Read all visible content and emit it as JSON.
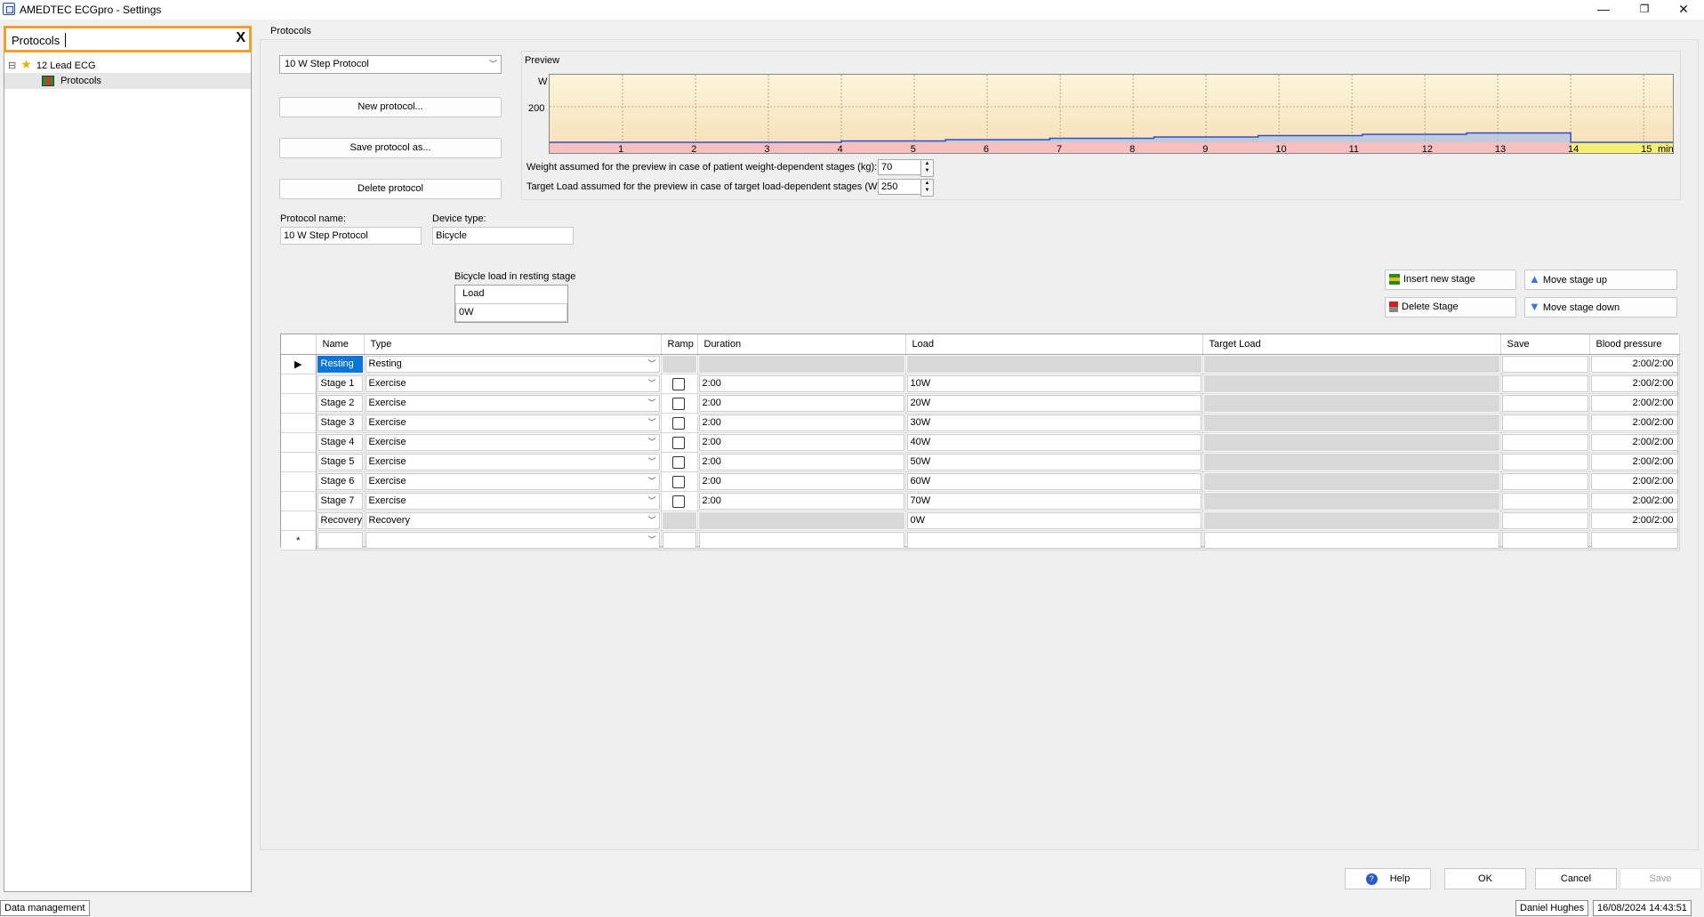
{
  "window": {
    "title": "AMEDTEC ECGpro  -  Settings",
    "minimize": "—",
    "restore": "❐",
    "close": "✕"
  },
  "search": {
    "value": "Protocols",
    "clear": "X"
  },
  "tree": {
    "root": "12 Lead ECG",
    "expander": "⊟",
    "child": "Protocols"
  },
  "group_title": "Protocols",
  "protocol_select": {
    "value": "10 W Step Protocol"
  },
  "buttons": {
    "new_protocol": "New protocol...",
    "save_protocol_as": "Save protocol as...",
    "delete_protocol": "Delete protocol",
    "insert_stage": "Insert new stage",
    "move_up": "Move stage up",
    "delete_stage": "Delete Stage",
    "move_down": "Move stage down",
    "help": "Help",
    "ok": "OK",
    "cancel": "Cancel",
    "save": "Save"
  },
  "preview": {
    "title": "Preview",
    "y_unit": "W",
    "y_tick": "200",
    "x_ticks": [
      "1",
      "2",
      "3",
      "4",
      "5",
      "6",
      "7",
      "8",
      "9",
      "10",
      "11",
      "12",
      "13",
      "14",
      "15",
      "min"
    ],
    "stage_loads_w": [
      0,
      0,
      0,
      0,
      10,
      20,
      30,
      40,
      50,
      60,
      70,
      0
    ],
    "weight_label": "Weight assumed for the preview in case of patient weight-dependent stages (kg):",
    "weight_value": "70",
    "target_label": "Target Load assumed for the preview in case of target load-dependent stages (W):",
    "target_value": "250"
  },
  "protocol_name": {
    "label": "Protocol name:",
    "value": "10 W Step Protocol"
  },
  "device_type": {
    "label": "Device type:",
    "value": "Bicycle"
  },
  "resting_load": {
    "label": "Bicycle load in resting stage",
    "header": "Load",
    "value": "0W"
  },
  "table": {
    "columns": [
      "Name",
      "Type",
      "Ramp",
      "Duration",
      "Load",
      "Target Load",
      "Save",
      "Blood pressure"
    ],
    "rows": [
      {
        "marker": "▶",
        "name": "Resting",
        "type": "Resting",
        "ramp": false,
        "duration": "",
        "load": "",
        "bp": "2:00/2:00"
      },
      {
        "marker": "",
        "name": "Stage 1",
        "type": "Exercise",
        "ramp": true,
        "duration": "2:00",
        "load": "10W",
        "bp": "2:00/2:00"
      },
      {
        "marker": "",
        "name": "Stage 2",
        "type": "Exercise",
        "ramp": true,
        "duration": "2:00",
        "load": "20W",
        "bp": "2:00/2:00"
      },
      {
        "marker": "",
        "name": "Stage 3",
        "type": "Exercise",
        "ramp": true,
        "duration": "2:00",
        "load": "30W",
        "bp": "2:00/2:00"
      },
      {
        "marker": "",
        "name": "Stage 4",
        "type": "Exercise",
        "ramp": true,
        "duration": "2:00",
        "load": "40W",
        "bp": "2:00/2:00"
      },
      {
        "marker": "",
        "name": "Stage 5",
        "type": "Exercise",
        "ramp": true,
        "duration": "2:00",
        "load": "50W",
        "bp": "2:00/2:00"
      },
      {
        "marker": "",
        "name": "Stage 6",
        "type": "Exercise",
        "ramp": true,
        "duration": "2:00",
        "load": "60W",
        "bp": "2:00/2:00"
      },
      {
        "marker": "",
        "name": "Stage 7",
        "type": "Exercise",
        "ramp": true,
        "duration": "2:00",
        "load": "70W",
        "bp": "2:00/2:00"
      },
      {
        "marker": "",
        "name": "Recovery",
        "type": "Recovery",
        "ramp": false,
        "duration": "",
        "load": "0W",
        "bp": "2:00/2:00"
      }
    ],
    "new_row_marker": "*"
  },
  "statusbar": {
    "left": "Data management",
    "user": "Daniel Hughes",
    "datetime": "16/08/2024 14:43:51"
  },
  "colors": {
    "accent": "#0a74da",
    "search_border": "#f0a030",
    "preview_line": "#3050c8"
  }
}
